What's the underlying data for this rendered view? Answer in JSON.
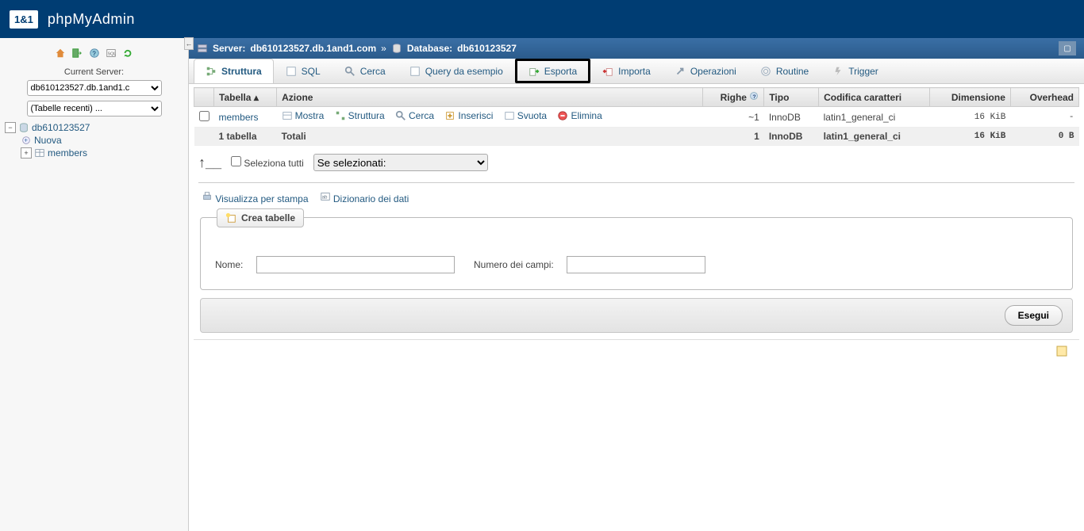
{
  "brand": {
    "logo": "1&1",
    "name": "phpMyAdmin"
  },
  "sidebar": {
    "current_server_label": "Current Server:",
    "server_select": "db610123527.db.1and1.c",
    "recent_select": "(Tabelle recenti) ...",
    "db": "db610123527",
    "nuova": "Nuova",
    "table": "members"
  },
  "breadcrumb": {
    "server_label": "Server:",
    "server": "db610123527.db.1and1.com",
    "sep": "»",
    "db_label": "Database:",
    "db": "db610123527"
  },
  "tabs": {
    "struttura": "Struttura",
    "sql": "SQL",
    "cerca": "Cerca",
    "query": "Query da esempio",
    "esporta": "Esporta",
    "importa": "Importa",
    "operazioni": "Operazioni",
    "routine": "Routine",
    "trigger": "Trigger"
  },
  "table_headers": {
    "tabella": "Tabella",
    "azione": "Azione",
    "righe": "Righe",
    "tipo": "Tipo",
    "codifica": "Codifica caratteri",
    "dimensione": "Dimensione",
    "overhead": "Overhead"
  },
  "row": {
    "name": "members",
    "mostra": "Mostra",
    "struttura": "Struttura",
    "cerca": "Cerca",
    "inserisci": "Inserisci",
    "svuota": "Svuota",
    "elimina": "Elimina",
    "righe": "~1",
    "tipo": "InnoDB",
    "codifica": "latin1_general_ci",
    "dimensione": "16 KiB",
    "overhead": "-"
  },
  "totals": {
    "label": "1 tabella",
    "totali": "Totali",
    "righe": "1",
    "tipo": "InnoDB",
    "codifica": "latin1_general_ci",
    "dimensione": "16 KiB",
    "overhead": "0 B"
  },
  "below": {
    "select_all": "Seleziona tutti",
    "if_selected": "Se selezionati:"
  },
  "links": {
    "print": "Visualizza per stampa",
    "dict": "Dizionario dei dati"
  },
  "create": {
    "legend": "Crea tabelle",
    "name_label": "Nome:",
    "fields_label": "Numero dei campi:",
    "submit": "Esegui"
  }
}
